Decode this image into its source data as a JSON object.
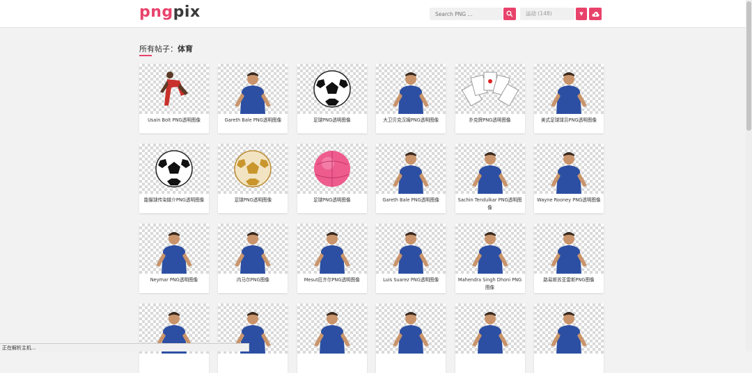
{
  "header": {
    "logo_part1": "png",
    "logo_part2": "pix",
    "search_placeholder": "Search PNG ...",
    "category_select": "运动 (148)"
  },
  "section": {
    "label": "所有帖子：",
    "category": "体育"
  },
  "cards": [
    {
      "caption": "Usain Bolt PNG透明图像",
      "icon": "sprinter-image"
    },
    {
      "caption": "Gareth Bale PNG透明图像",
      "icon": "player-image"
    },
    {
      "caption": "足球PNG透明图像",
      "icon": "soccer-ball-image"
    },
    {
      "caption": "大卫贝克汉姆PNG透明图像",
      "icon": "player-image"
    },
    {
      "caption": "扑克牌PNG透明图像",
      "icon": "playing-cards-image"
    },
    {
      "caption": "美式足球球员PNG透明图像",
      "icon": "player-image"
    },
    {
      "caption": "能猫球传染媒介PNG透明图像",
      "icon": "soccer-ball-image"
    },
    {
      "caption": "足球PNG透明图像",
      "icon": "gold-ball-image"
    },
    {
      "caption": "足球PNG透明图像",
      "icon": "pink-ball-image"
    },
    {
      "caption": "Gareth Bale PNG透明图像",
      "icon": "player-image"
    },
    {
      "caption": "Sachin Tendulkar PNG透明图像",
      "icon": "player-image"
    },
    {
      "caption": "Wayne Rooney PNG透明图像",
      "icon": "player-image"
    },
    {
      "caption": "Neymar PNG透明图像",
      "icon": "player-image"
    },
    {
      "caption": "内马尔PNG图像",
      "icon": "player-image"
    },
    {
      "caption": "Mesut厄齐尔PNG透明图像",
      "icon": "player-image"
    },
    {
      "caption": "Luis Suarez PNG透明图像",
      "icon": "player-image"
    },
    {
      "caption": "Mahendra Singh Dhoni PNG 图像",
      "icon": "player-image"
    },
    {
      "caption": "路易斯苏亚雷斯PNG图像",
      "icon": "player-image"
    },
    {
      "caption": "",
      "icon": "player-image"
    },
    {
      "caption": "",
      "icon": "player-image"
    },
    {
      "caption": "",
      "icon": "player-image"
    },
    {
      "caption": "",
      "icon": "player-image"
    },
    {
      "caption": "",
      "icon": "player-image"
    },
    {
      "caption": "",
      "icon": "player-image"
    }
  ],
  "status_bar": "正在解析主机...",
  "colors": {
    "accent": "#e8426b"
  }
}
